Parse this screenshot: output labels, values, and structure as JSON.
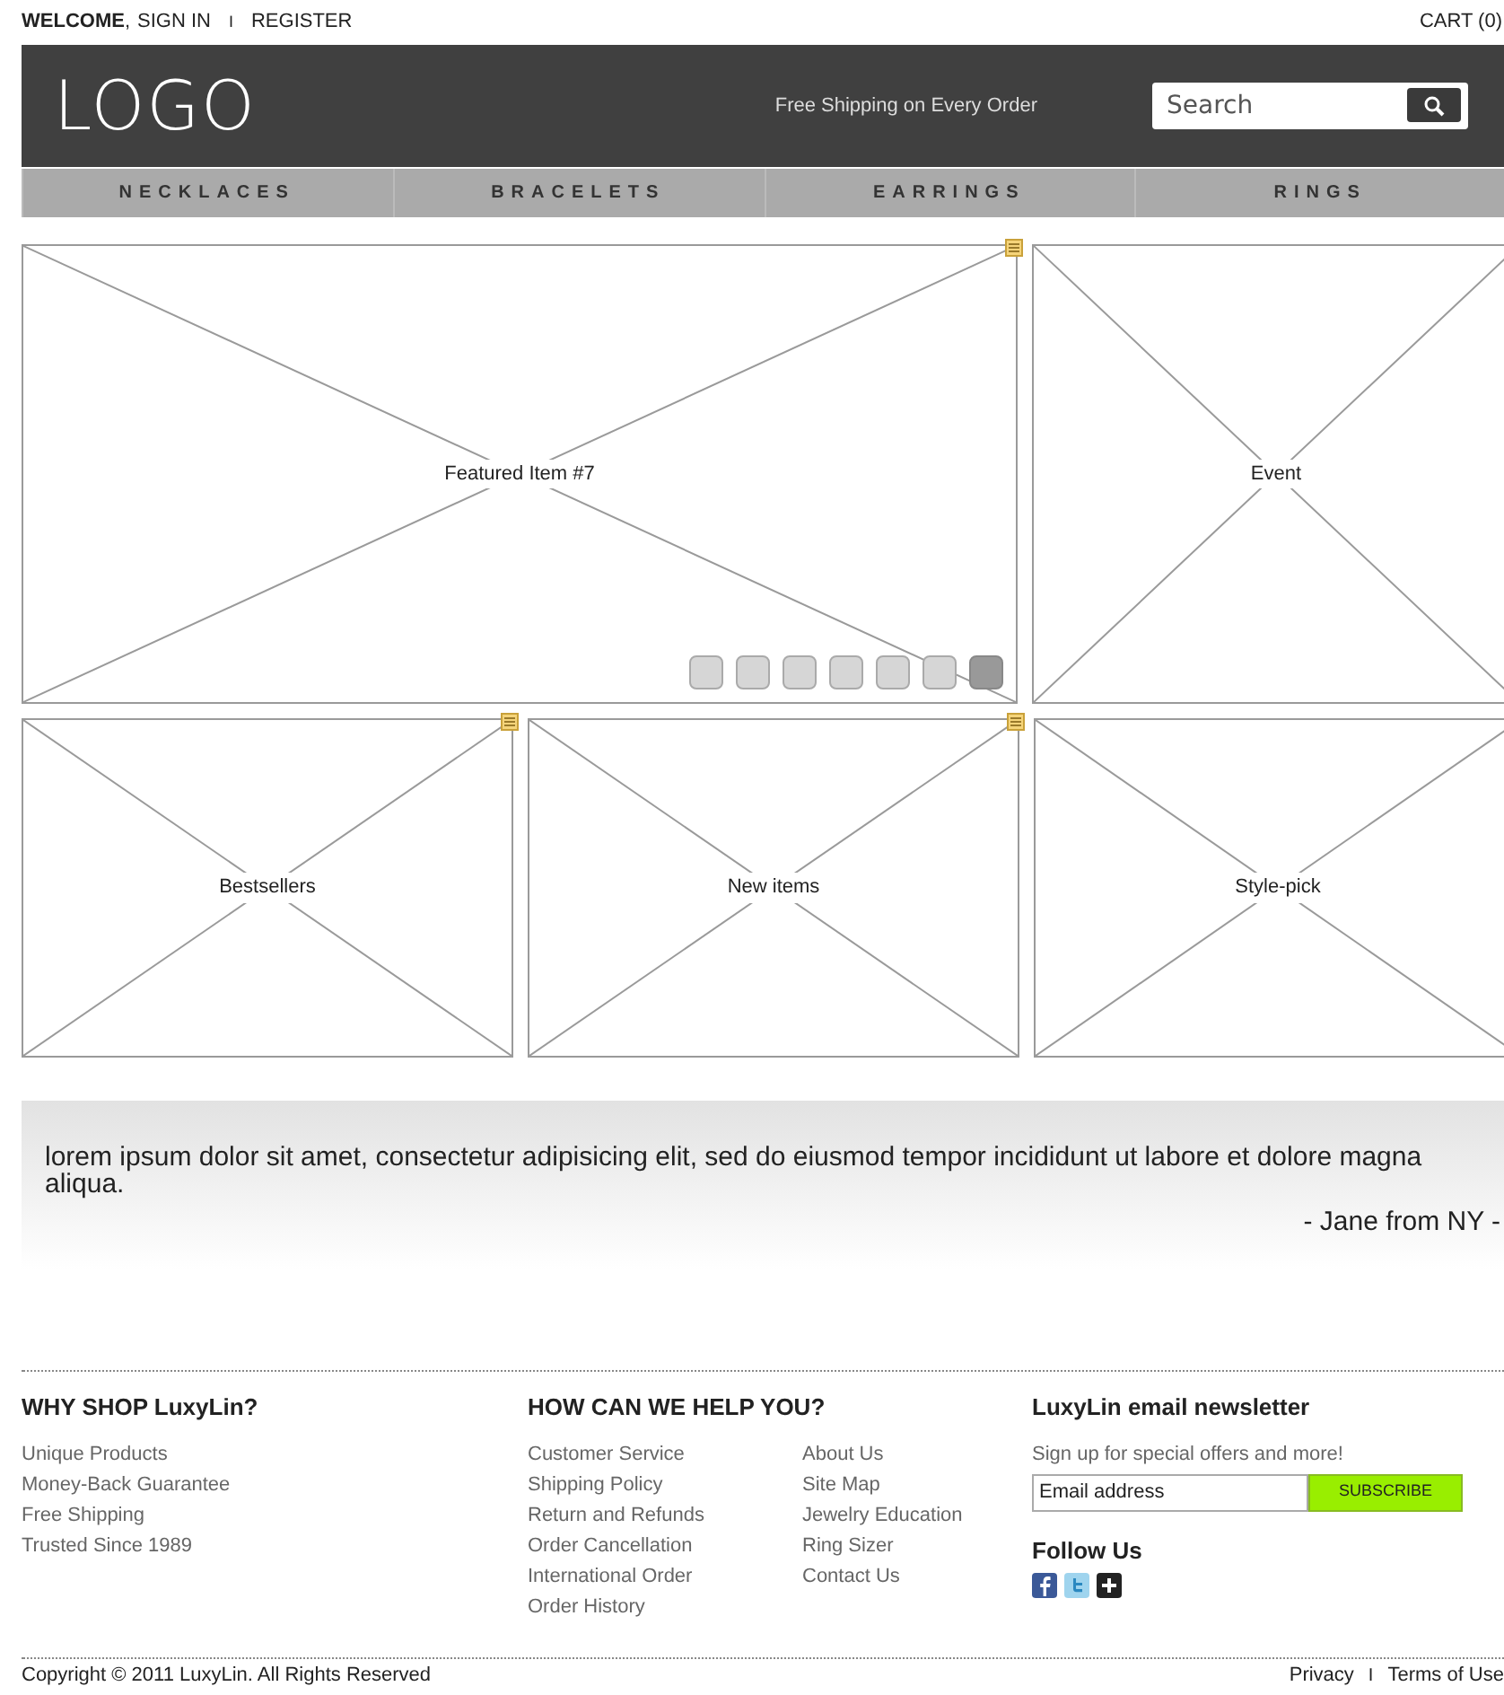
{
  "top_bar": {
    "welcome": "WELCOME",
    "comma": ",",
    "sign_in": "SIGN IN",
    "separator": "I",
    "register": "REGISTER",
    "cart": "CART (0)"
  },
  "header": {
    "logo": "LOGO",
    "tagline": "Free Shipping on Every Order",
    "search": {
      "placeholder": "Search"
    }
  },
  "nav": [
    {
      "label": "NECKLACES"
    },
    {
      "label": "BRACELETS"
    },
    {
      "label": "EARRINGS"
    },
    {
      "label": "RINGS"
    }
  ],
  "featured": {
    "label": "Featured Item #7",
    "slides": [
      {
        "selected": false
      },
      {
        "selected": false
      },
      {
        "selected": false
      },
      {
        "selected": false
      },
      {
        "selected": false
      },
      {
        "selected": false
      },
      {
        "selected": true
      }
    ]
  },
  "event": {
    "label": "Event"
  },
  "tiles": [
    {
      "label": "Bestsellers",
      "note": true
    },
    {
      "label": "New items",
      "note": true
    },
    {
      "label": "Style-pick"
    }
  ],
  "testimonial": {
    "quote": "lorem ipsum dolor sit amet, consectetur adipisicing elit, sed do eiusmod tempor incididunt ut labore et dolore magna aliqua.",
    "author": "- Jane from NY -"
  },
  "footer": {
    "why": {
      "title": "WHY SHOP LuxyLin?",
      "items": [
        "Unique Products",
        "Money-Back Guarantee",
        "Free Shipping",
        "Trusted Since 1989"
      ]
    },
    "help": {
      "title": "HOW CAN WE HELP YOU?",
      "column_1": [
        "Customer Service",
        "Shipping Policy",
        "Return and Refunds",
        "Order Cancellation",
        "International Order",
        "Order History"
      ],
      "column_2": [
        "About Us",
        "Site Map",
        "Jewelry Education",
        "Ring Sizer",
        "Contact Us"
      ]
    },
    "newsletter": {
      "title": "LuxyLin email newsletter",
      "text": "Sign up for special offers and more!",
      "email": {
        "placeholder": "Email address"
      },
      "button": "SUBSCRIBE"
    },
    "follow": {
      "title": "Follow Us",
      "networks": [
        {
          "kind": "facebook"
        },
        {
          "kind": "twitter"
        },
        {
          "kind": "plus"
        }
      ]
    }
  },
  "bottom": {
    "copyright": "Copyright © 2011 LuxyLin. All Rights Reserved",
    "links": [
      "Privacy",
      "Terms of Use"
    ],
    "separator": "I"
  }
}
